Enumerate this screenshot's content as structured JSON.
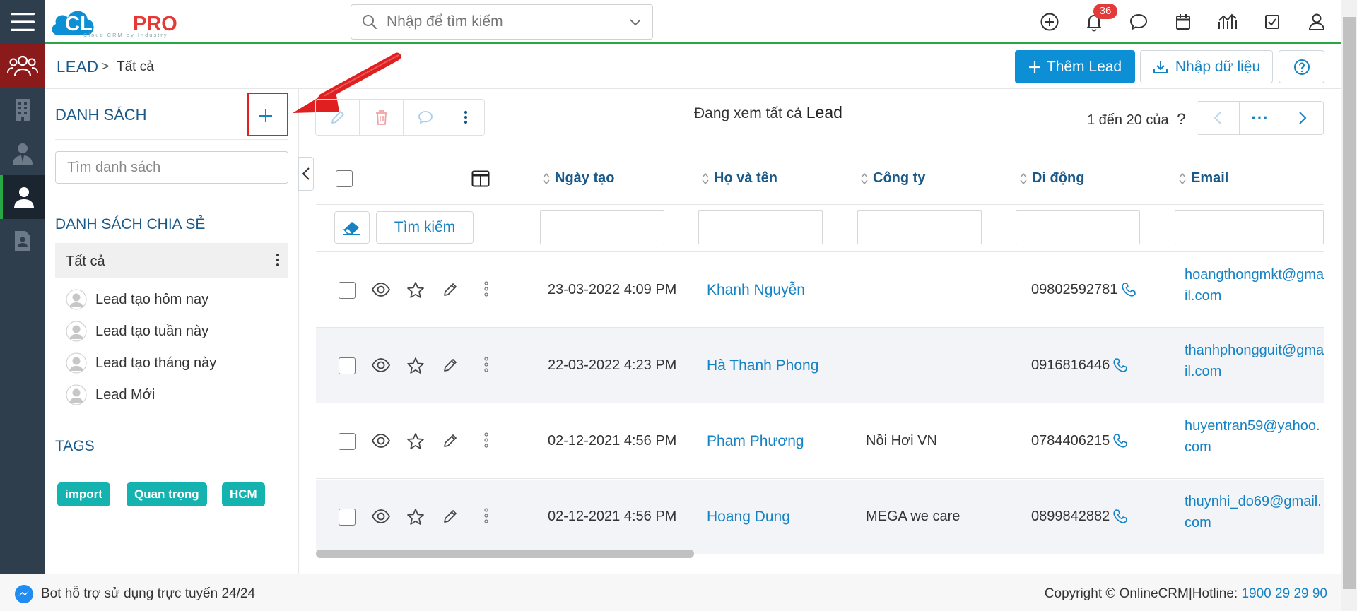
{
  "brand": {
    "logo_text": "CLOUDPRO",
    "tagline": "Cloud CRM by Industry"
  },
  "search": {
    "placeholder": "Nhập để tìm kiếm"
  },
  "notifications": {
    "count": "36"
  },
  "breadcrumb": {
    "module": "LEAD",
    "separator": ">",
    "current": "Tất cả"
  },
  "actions": {
    "add_lead": "Thêm Lead",
    "import_data": "Nhập dữ liệu"
  },
  "sidebar": {
    "title": "DANH SÁCH",
    "search_placeholder": "Tìm danh sách",
    "shared_title": "DANH SÁCH CHIA SẺ",
    "all_label": "Tất cả",
    "lists": [
      {
        "label": "Lead tạo hôm nay"
      },
      {
        "label": "Lead tạo tuần này"
      },
      {
        "label": "Lead tạo tháng này"
      },
      {
        "label": "Lead Mới"
      }
    ],
    "tags_title": "TAGS",
    "tags": [
      {
        "label": "import"
      },
      {
        "label": "Quan trọng"
      },
      {
        "label": "HCM"
      }
    ]
  },
  "main": {
    "viewing_prefix": "Đang xem tất cả",
    "viewing_module": "Lead",
    "page_range": "1 đến 20 của",
    "page_total": "?",
    "pager_more": "···",
    "find_button": "Tìm kiếm"
  },
  "table": {
    "columns": [
      {
        "label": "Ngày tạo"
      },
      {
        "label": "Họ và tên"
      },
      {
        "label": "Công ty"
      },
      {
        "label": "Di động"
      },
      {
        "label": "Email"
      }
    ],
    "rows": [
      {
        "date": "23-03-2022 4:09 PM",
        "name": "Khanh Nguyễn",
        "company": "",
        "mobile": "09802592781",
        "email": "hoangthongmkt@gmail.com"
      },
      {
        "date": "22-03-2022 4:23 PM",
        "name": "Hà Thanh Phong",
        "company": "",
        "mobile": "0916816446",
        "email": "thanhphongguit@gmail.com"
      },
      {
        "date": "02-12-2021 4:56 PM",
        "name": "Pham Phương",
        "company": "Nồi Hơi VN",
        "mobile": "0784406215",
        "email": "huyentran59@yahoo.com"
      },
      {
        "date": "02-12-2021 4:56 PM",
        "name": "Hoang Dung",
        "company": "MEGA we care",
        "mobile": "0899842882",
        "email": "thuynhi_do69@gmail.com"
      }
    ]
  },
  "footer": {
    "bot_text": "Bot hỗ trợ sử dụng trực tuyến 24/24",
    "copyright": "Copyright © OnlineCRM|Hotline: ",
    "hotline": "1900 29 29 90"
  },
  "colors": {
    "primary": "#0d8fd6",
    "nav_bg": "#2f3e4d",
    "active_nav": "#8b1a1a",
    "tag": "#14b3b0",
    "link": "#1582c4",
    "heading": "#1a5a8a",
    "badge": "#e23b3b",
    "highlight": "#e02020"
  },
  "icons": [
    "menu-icon",
    "search-icon",
    "chevron-down-icon",
    "plus-circle-icon",
    "bell-icon",
    "chat-icon",
    "calendar-icon",
    "chart-icon",
    "checkbox-icon",
    "user-icon",
    "users-icon",
    "building-icon",
    "contact-icon",
    "person-icon",
    "document-icon",
    "upload-icon",
    "help-icon",
    "plus-icon",
    "edit-icon",
    "trash-icon",
    "comment-icon",
    "more-icon",
    "eye-icon",
    "star-icon",
    "pencil-icon",
    "phone-icon",
    "eraser-icon",
    "columns-icon",
    "sort-icon",
    "messenger-icon"
  ]
}
